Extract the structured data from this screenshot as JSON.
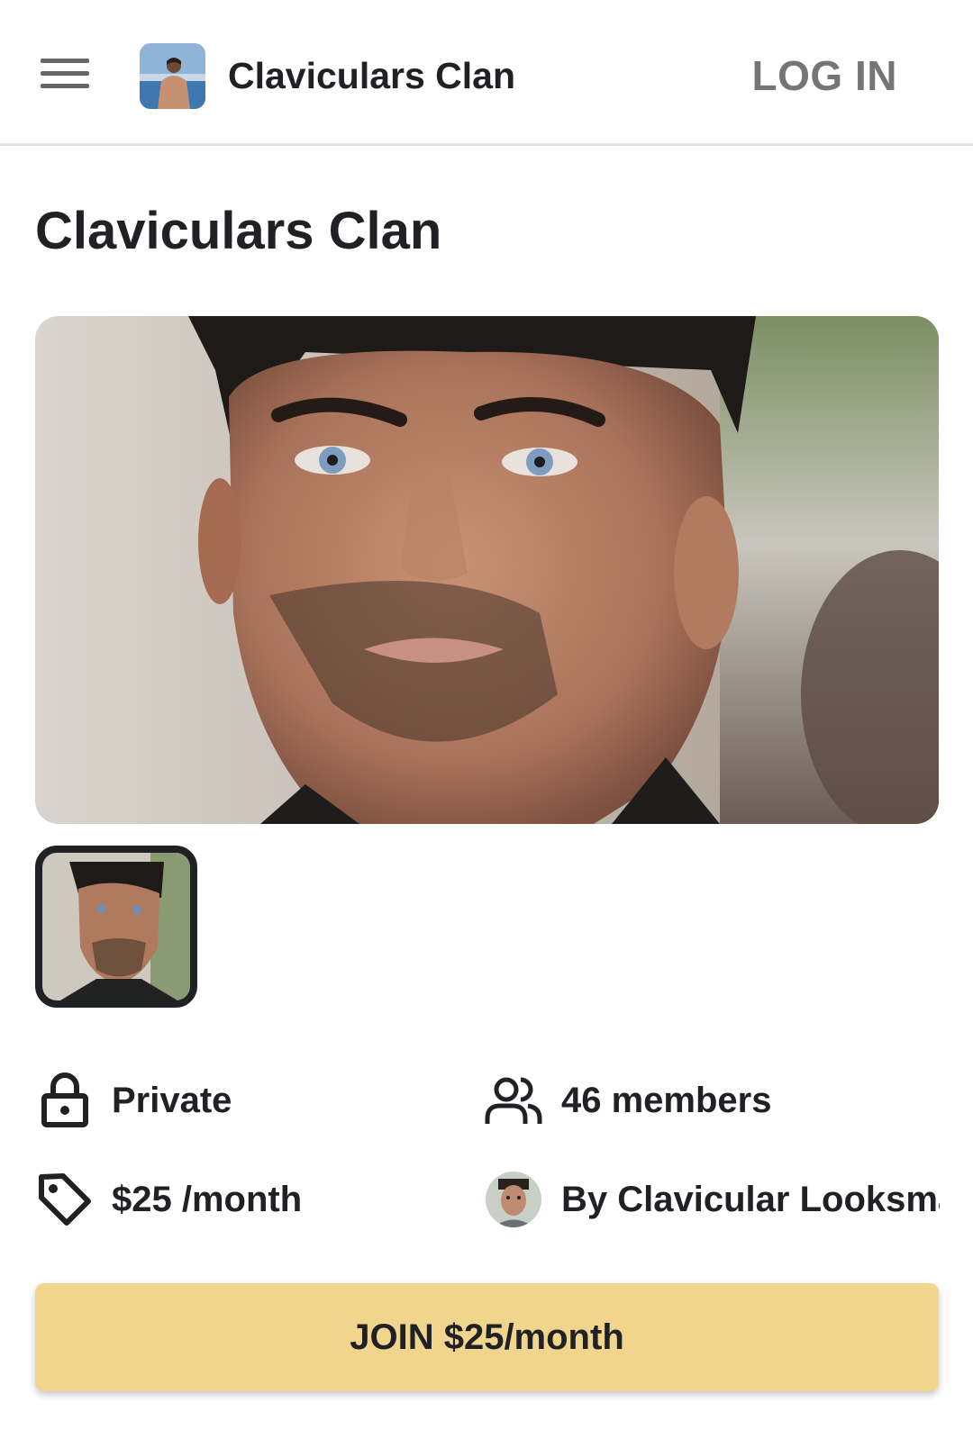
{
  "header": {
    "brand_name": "Claviculars Clan",
    "login_label": "LOG IN",
    "menu_icon": "hamburger-menu-icon"
  },
  "page": {
    "title": "Claviculars Clan"
  },
  "gallery": {
    "selected_index": 0,
    "thumbnail_count": 1
  },
  "info": {
    "privacy": {
      "icon": "lock-icon",
      "label": "Private"
    },
    "members": {
      "icon": "users-icon",
      "label": "46 members"
    },
    "price": {
      "icon": "price-tag-icon",
      "label": "$25 /month"
    },
    "creator": {
      "icon": "creator-avatar",
      "label": "By Clavicular Looksmaxxing"
    }
  },
  "join": {
    "label": "JOIN $25/month",
    "color": "#f2d58d"
  },
  "colors": {
    "text": "#202124",
    "muted": "#757575",
    "divider": "#e3e3e3",
    "accent": "#f2d58d"
  }
}
